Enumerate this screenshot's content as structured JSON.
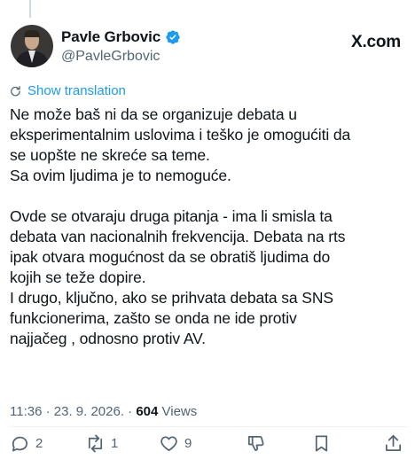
{
  "tweet": {
    "author": {
      "display_name": "Pavle Grbovic",
      "handle": "@PavleGrbovic"
    },
    "site_label": "X.com",
    "translate_label": "Show translation",
    "text": "Ne može baš ni da se organizuje debata u\neksperimentalnim uslovima i teško je omogućiti da\nse uopšte ne skreće sa teme.\nSa ovim ljudima je to nemoguće.\n\nOvde se otvaraju druga pitanja - ima li smisla ta\ndebata van nacionalnih frekvencija. Debata na rts\nipak otvara mogućnost da se obratiš ljudima do\nkojih se teže dopire.\nI drugo, ključno, ako se prihvata debata sa SNS\nfunkcionerima, zašto se onda ne ide protiv\nnajjačeg , odnosno protiv AV.",
    "timestamp": "11:36 · 23. 9. 2026. · ",
    "views_count": "604",
    "views_label": " Views",
    "stats": {
      "replies": "2",
      "reposts": "1",
      "likes": "9"
    },
    "colors": {
      "accent": "#1d9bf0",
      "secondary_text": "#536471",
      "primary_text": "#0f1419"
    }
  }
}
